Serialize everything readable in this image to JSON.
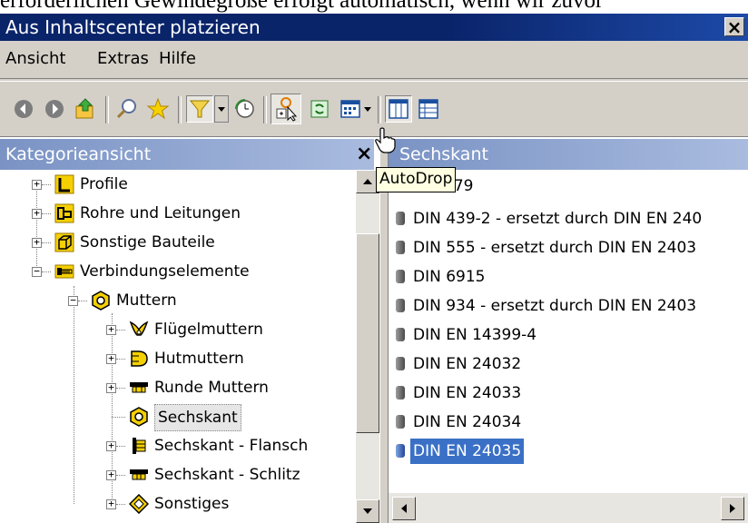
{
  "doc_line": "erforderlichen Gewindegröße erfolgt automatisch, wenn wir zuvor",
  "window": {
    "title": "Aus Inhaltscenter platzieren",
    "close": "×"
  },
  "menu": [
    "Ansicht",
    "Extras",
    "Hilfe"
  ],
  "toolbar": {
    "buttons": [
      "back-icon",
      "forward-icon",
      "up-folder-icon",
      "search-icon",
      "favorites-icon",
      "filter-icon",
      "dropdown-arrow-icon",
      "refresh-clock-icon",
      "autodrop-icon",
      "update-icon",
      "view-options-icon",
      "dropdown-arrow-icon",
      "tree-view-icon",
      "table-view-icon"
    ],
    "tooltip": "AutoDrop"
  },
  "left_pane": {
    "header": "Kategorieansicht",
    "close": "×",
    "tree": [
      {
        "label": "Profile",
        "expander": "+",
        "icon": "profile-icon"
      },
      {
        "label": "Rohre und Leitungen",
        "expander": "+",
        "icon": "pipes-icon"
      },
      {
        "label": "Sonstige Bauteile",
        "expander": "+",
        "icon": "cube-icon"
      },
      {
        "label": "Verbindungselemente",
        "expander": "−",
        "icon": "bolt-icon"
      },
      {
        "label": "Muttern",
        "expander": "−",
        "icon": "hex-nut-icon"
      },
      {
        "label": "Flügelmuttern",
        "expander": "+",
        "icon": "wing-nut-icon"
      },
      {
        "label": "Hutmuttern",
        "expander": "+",
        "icon": "cap-nut-icon"
      },
      {
        "label": "Runde Muttern",
        "expander": "+",
        "icon": "round-nut-icon"
      },
      {
        "label": "Sechskant",
        "expander": "",
        "icon": "hex-nut-icon"
      },
      {
        "label": "Sechskant - Flansch",
        "expander": "+",
        "icon": "flange-nut-icon"
      },
      {
        "label": "Sechskant - Schlitz",
        "expander": "+",
        "icon": "slotted-nut-icon"
      },
      {
        "label": "Sonstiges",
        "expander": "+",
        "icon": "diamond-icon"
      }
    ]
  },
  "right_pane": {
    "header": "Sechskant",
    "items": [
      "479",
      "DIN 439-2 - ersetzt durch DIN EN 240",
      "DIN 555 - ersetzt durch DIN EN 2403",
      "DIN 6915",
      "DIN 934 - ersetzt durch DIN EN 2403",
      "DIN EN 14399-4",
      "DIN EN 24032",
      "DIN EN 24033",
      "DIN EN 24034",
      "DIN EN 24035"
    ],
    "selected": "DIN EN 24035"
  },
  "colors": {
    "title_bar": "#0a246a",
    "pane_header": "#7a93c4",
    "selection": "#3a70c6",
    "chrome": "#d4d0c8",
    "folder": "#f5d000"
  }
}
